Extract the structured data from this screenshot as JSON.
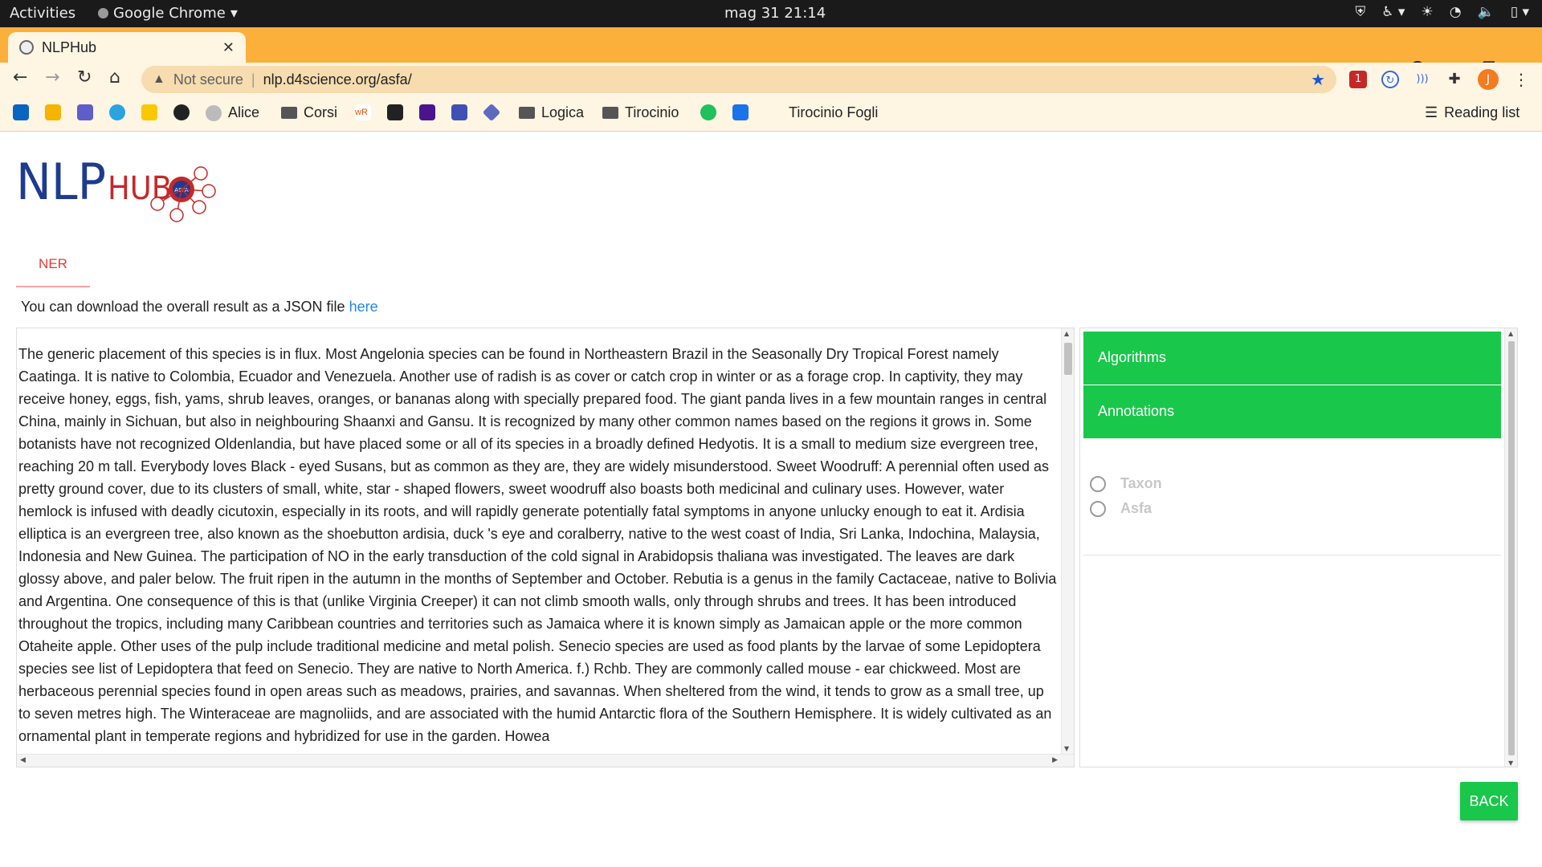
{
  "os": {
    "activities": "Activities",
    "app_name": "Google Chrome",
    "clock": "mag 31  21:14"
  },
  "browser": {
    "tab_title": "NLPHub",
    "omnibox": {
      "security_label": "Not secure",
      "url": "nlp.d4science.org/asfa/"
    },
    "bookmarks": [
      {
        "label": "Alice"
      },
      {
        "label": "Corsi"
      },
      {
        "label": "Logica"
      },
      {
        "label": "Tirocinio"
      },
      {
        "label": "Tirocinio Fogli"
      },
      {
        "label": "Reading list"
      }
    ],
    "profile_initial": "J",
    "extension_badge": "1"
  },
  "logo": {
    "text": "NLPHUB",
    "badge": "ASFA"
  },
  "page": {
    "tab_label": "NER",
    "download_text": "You can download the overall result as a JSON file",
    "download_link": "here",
    "body_text": "The generic placement of this species is in flux. Most Angelonia species can be found in Northeastern Brazil in the Seasonally Dry Tropical Forest namely Caatinga. It is native to Colombia, Ecuador and Venezuela. Another use of radish is as cover or catch crop in winter or as a forage crop. In captivity, they may receive honey, eggs, fish, yams, shrub leaves, oranges, or bananas along with specially prepared food. The giant panda lives in a few mountain ranges in central China, mainly in Sichuan, but also in neighbouring Shaanxi and Gansu. It is recognized by many other common names based on the regions it grows in. Some botanists have not recognized Oldenlandia, but have placed some or all of its species in a broadly defined Hedyotis. It is a small to medium size evergreen tree, reaching 20 m tall. Everybody loves Black - eyed Susans, but as common as they are, they are widely misunderstood. Sweet Woodruff: A perennial often used as pretty ground cover, due to its clusters of small, white, star - shaped flowers, sweet woodruff also boasts both medicinal and culinary uses. However, water hemlock is infused with deadly cicutoxin, especially in its roots, and will rapidly generate potentially fatal symptoms in anyone unlucky enough to eat it. Ardisia elliptica is an evergreen tree, also known as the shoebutton ardisia, duck 's eye and coralberry, native to the west coast of India, Sri Lanka, Indochina, Malaysia, Indonesia and New Guinea. The participation of NO in the early transduction of the cold signal in Arabidopsis thaliana was investigated. The leaves are dark glossy above, and paler below. The fruit ripen in the autumn in the months of September and October. Rebutia is a genus in the family Cactaceae, native to Bolivia and Argentina. One consequence of this is that (unlike Virginia Creeper) it can not climb smooth walls, only through shrubs and trees. It has been introduced throughout the tropics, including many Caribbean countries and territories such as Jamaica where it is known simply as Jamaican apple or the more common Otaheite apple. Other uses of the pulp include traditional medicine and metal polish. Senecio species are used as food plants by the larvae of some Lepidoptera species see list of Lepidoptera that feed on Senecio. They are native to North America. f.) Rchb. They are commonly called mouse - ear chickweed. Most are herbaceous perennial species found in open areas such as meadows, prairies, and savannas. When sheltered from the wind, it tends to grow as a small tree, up to seven metres high. The Winteraceae are magnoliids, and are associated with the humid Antarctic flora of the Southern Hemisphere. It is widely cultivated as an ornamental plant in temperate regions and hybridized for use in the garden. Howea"
  },
  "sidebar": {
    "algorithms_label": "Algorithms",
    "annotations_label": "Annotations",
    "options": [
      {
        "label": "Taxon"
      },
      {
        "label": "Asfa"
      }
    ]
  },
  "actions": {
    "back_label": "BACK"
  },
  "colors": {
    "accent_green": "#19c74b",
    "chrome_orange": "#fbb03b",
    "ner_red": "#e53935",
    "link_blue": "#1e88e5"
  }
}
